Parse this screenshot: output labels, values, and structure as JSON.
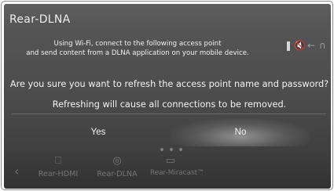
{
  "screen": {
    "title": "Rear-DLNA"
  },
  "info": {
    "line1": "Using Wi-Fi, connect to the following access point",
    "line2": "and send content from a DLNA application on your mobile device."
  },
  "status_icons": [
    "signal-bar-icon",
    "speaker-muted-icon",
    "back-arrow-icon",
    "headphones-icon"
  ],
  "dialog": {
    "question": "Are you sure you want to refresh the access point name and password?",
    "subtext": "Refreshing will cause all connections to be removed.",
    "yes_label": "Yes",
    "no_label": "No"
  },
  "dock": {
    "items": [
      {
        "label": "Rear-HDMI",
        "icon": "usb-plug-icon"
      },
      {
        "label": "Rear-DLNA",
        "icon": "dlna-icon"
      },
      {
        "label": "Rear-Miracast™",
        "icon": "miracast-screen-icon"
      }
    ]
  },
  "colors": {
    "background": "#4c4c4c",
    "text": "#f4f4f4",
    "highlight": "#ffffff"
  }
}
